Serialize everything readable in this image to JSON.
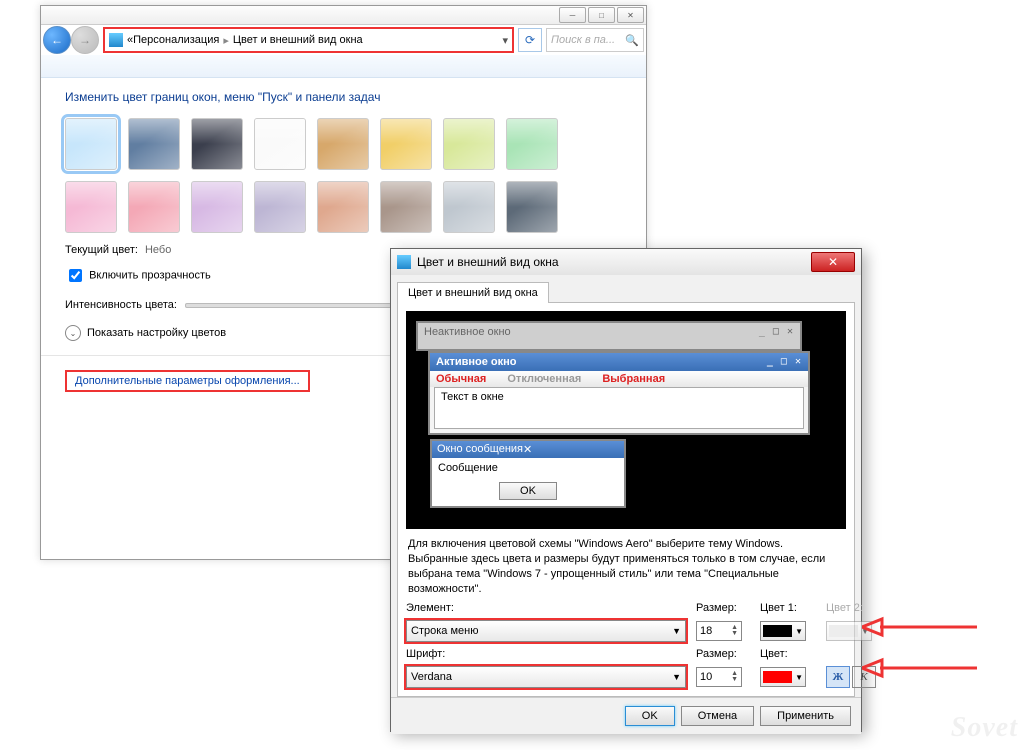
{
  "main": {
    "breadcrumb": {
      "parent": "Персонализация",
      "current": "Цвет и внешний вид окна",
      "prefix": "«"
    },
    "search_placeholder": "Поиск в па...",
    "title": "Изменить цвет границ окон, меню \"Пуск\" и панели задач",
    "colors_row1": [
      "#c7e6fb",
      "#617ea1",
      "#3b3f4d",
      "#fafafa",
      "#d7a86b",
      "#f1cf68",
      "#d8e89a",
      "#a9e4b6"
    ],
    "colors_row2": [
      "#f5b9d5",
      "#f4a8b6",
      "#d7b9e4",
      "#bdb6d4",
      "#dfa88e",
      "#a9968b",
      "#bfc7cf",
      "#5d6a78"
    ],
    "current_color_label": "Текущий цвет:",
    "current_color_value": "Небо",
    "transparency_label": "Включить прозрачность",
    "intensity_label": "Интенсивность цвета:",
    "expander_label": "Показать настройку цветов",
    "advanced_link": "Дополнительные параметры оформления..."
  },
  "dialog": {
    "title": "Цвет и внешний вид окна",
    "tab": "Цвет и внешний вид окна",
    "preview": {
      "inactive": "Неактивное окно",
      "active": "Активное окно",
      "menu_normal": "Обычная",
      "menu_disabled": "Отключенная",
      "menu_selected": "Выбранная",
      "text_in_window": "Текст в окне",
      "msg_title": "Окно сообщения",
      "msg_body": "Сообщение",
      "msg_ok": "OK"
    },
    "description": "Для включения цветовой схемы \"Windows Aero\" выберите тему Windows. Выбранные здесь цвета и размеры будут применяться только в том случае, если выбрана тема \"Windows 7 - упрощенный стиль\" или тема \"Специальные возможности\".",
    "labels": {
      "element": "Элемент:",
      "size": "Размер:",
      "color1": "Цвет 1:",
      "color2": "Цвет 2:",
      "font": "Шрифт:",
      "color": "Цвет:"
    },
    "element_value": "Строка меню",
    "element_size": "18",
    "element_color1": "#000000",
    "font_value": "Verdana",
    "font_size": "10",
    "font_color": "#ff0000",
    "bold": "Ж",
    "italic": "К",
    "btn_ok": "OK",
    "btn_cancel": "Отмена",
    "btn_apply": "Применить"
  },
  "watermark": "Sovet"
}
